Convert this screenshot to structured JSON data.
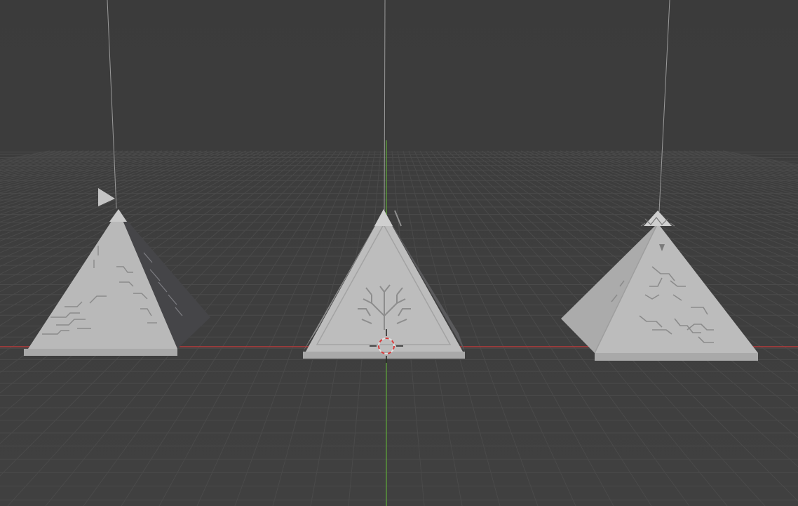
{
  "viewport": {
    "mode": "solid-shading",
    "background_color": "#3d3d3d",
    "grid_color": "#4a4a4a",
    "x_axis_color": "#b23a3a",
    "y_axis_color": "#5b9b3a",
    "object_color": "#b9b9b9",
    "object_shadow_color": "#454548"
  },
  "scene_objects": [
    {
      "id": "pyramid-left",
      "label": "",
      "selected": false,
      "has_cord": true
    },
    {
      "id": "pyramid-middle",
      "label": "",
      "selected": false,
      "has_cord": true
    },
    {
      "id": "pyramid-right",
      "label": "",
      "selected": false,
      "has_cord": true
    }
  ],
  "cursor_3d": {
    "visible": true
  },
  "camera_marker": {
    "visible": true
  }
}
